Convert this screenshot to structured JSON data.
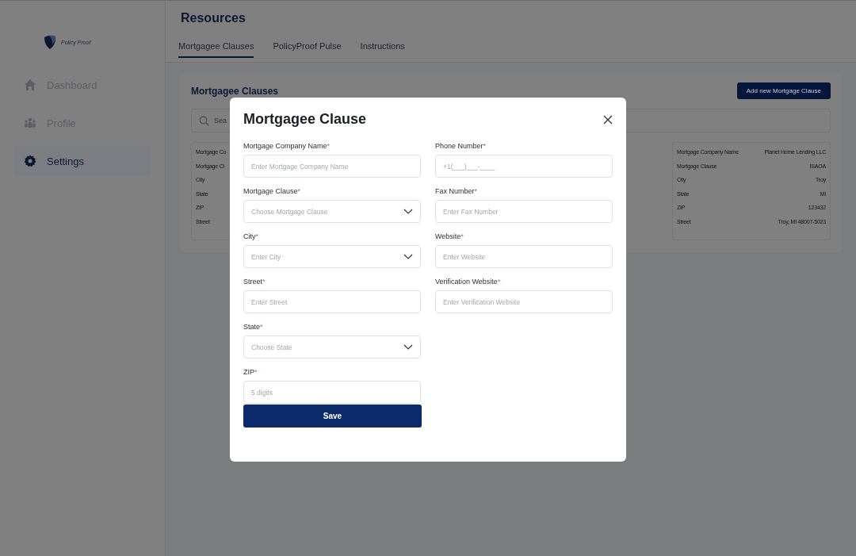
{
  "brand": {
    "name": "Policy Proof"
  },
  "sidebar": {
    "items": [
      {
        "label": "Dashboard",
        "selected": false
      },
      {
        "label": "Profile",
        "selected": false
      },
      {
        "label": "Settings",
        "selected": true
      }
    ]
  },
  "header": {
    "title": "Resources"
  },
  "tabs": [
    {
      "label": "Mortgagee Clauses",
      "selected": true
    },
    {
      "label": "PolicyProof Pulse",
      "selected": false
    },
    {
      "label": "Instructions",
      "selected": false
    }
  ],
  "panel": {
    "title": "Mortgagee Clauses",
    "add_button": "Add new Mortgage Clause",
    "search": {
      "placeholder": "Sea"
    },
    "cards": [
      {
        "rows": [
          {
            "label": "Mortgage Co"
          },
          {
            "label": "Mortgage Cl"
          },
          {
            "label": "City"
          },
          {
            "label": "State"
          },
          {
            "label": "ZIP"
          },
          {
            "label": "Street"
          }
        ]
      },
      {
        "rows": [
          {
            "label": "Mortgage Company Name",
            "value": "Planet Home Lending LLC"
          },
          {
            "label": "Mortgage Clause",
            "value": "ISAOA"
          },
          {
            "label": "City",
            "value": "Troy"
          },
          {
            "label": "State",
            "value": "MI"
          },
          {
            "label": "ZIP",
            "value": "123432"
          },
          {
            "label": "Street",
            "value": "Troy, MI 48007-5023"
          }
        ]
      }
    ]
  },
  "modal": {
    "title": "Mortgagee Clause",
    "save_button": "Save",
    "columns": [
      [
        {
          "label": "Mortgage Company Name",
          "mark": "*",
          "kind": "text",
          "placeholder": "Enter Mortgage Company Name"
        },
        {
          "label": "Mortgage Clause",
          "mark": "*",
          "kind": "select",
          "placeholder": "Choose Mortgage Clause"
        },
        {
          "label": "City",
          "mark": "*",
          "kind": "select",
          "placeholder": "Enter City"
        },
        {
          "label": "Street",
          "mark": "*",
          "kind": "text",
          "placeholder": "Enter Street"
        },
        {
          "label": "State",
          "mark": "*",
          "kind": "select",
          "placeholder": "Choose State"
        },
        {
          "label": "ZIP",
          "mark": "*",
          "kind": "text",
          "placeholder": "5 digits"
        }
      ],
      [
        {
          "label": "Phone Number",
          "mark": "*",
          "kind": "text",
          "placeholder": "+1(___)___-____"
        },
        {
          "label": "Fax Number",
          "mark": "*",
          "kind": "text",
          "placeholder": "Enter Fax Number"
        },
        {
          "label": "Website",
          "mark": "*",
          "kind": "text",
          "placeholder": "Enter Website"
        },
        {
          "label": "Verification Website",
          "mark": "*",
          "kind": "text",
          "placeholder": "Enter Verification Website"
        }
      ]
    ]
  }
}
